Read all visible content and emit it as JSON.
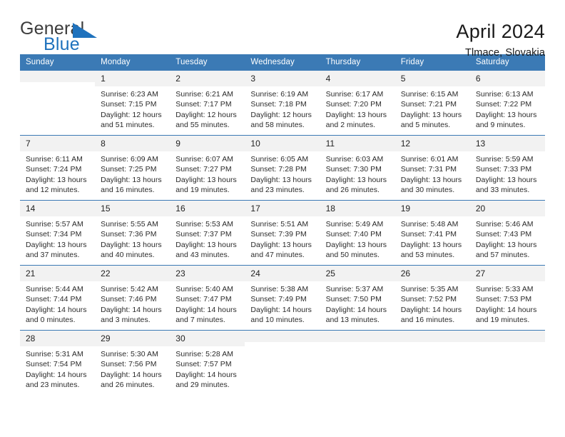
{
  "brand": {
    "word_one": "General",
    "word_two": "Blue",
    "logo_icon": "triangle-icon",
    "accent_color": "#1f72bd"
  },
  "header": {
    "month_title": "April 2024",
    "location": "Tlmace, Slovakia"
  },
  "calendar": {
    "header_color": "#3b7ab5",
    "weekdays": [
      "Sunday",
      "Monday",
      "Tuesday",
      "Wednesday",
      "Thursday",
      "Friday",
      "Saturday"
    ],
    "weeks": [
      [
        {
          "day": ""
        },
        {
          "day": "1",
          "sunrise": "Sunrise: 6:23 AM",
          "sunset": "Sunset: 7:15 PM",
          "daylight_line1": "Daylight: 12 hours",
          "daylight_line2": "and 51 minutes."
        },
        {
          "day": "2",
          "sunrise": "Sunrise: 6:21 AM",
          "sunset": "Sunset: 7:17 PM",
          "daylight_line1": "Daylight: 12 hours",
          "daylight_line2": "and 55 minutes."
        },
        {
          "day": "3",
          "sunrise": "Sunrise: 6:19 AM",
          "sunset": "Sunset: 7:18 PM",
          "daylight_line1": "Daylight: 12 hours",
          "daylight_line2": "and 58 minutes."
        },
        {
          "day": "4",
          "sunrise": "Sunrise: 6:17 AM",
          "sunset": "Sunset: 7:20 PM",
          "daylight_line1": "Daylight: 13 hours",
          "daylight_line2": "and 2 minutes."
        },
        {
          "day": "5",
          "sunrise": "Sunrise: 6:15 AM",
          "sunset": "Sunset: 7:21 PM",
          "daylight_line1": "Daylight: 13 hours",
          "daylight_line2": "and 5 minutes."
        },
        {
          "day": "6",
          "sunrise": "Sunrise: 6:13 AM",
          "sunset": "Sunset: 7:22 PM",
          "daylight_line1": "Daylight: 13 hours",
          "daylight_line2": "and 9 minutes."
        }
      ],
      [
        {
          "day": "7",
          "sunrise": "Sunrise: 6:11 AM",
          "sunset": "Sunset: 7:24 PM",
          "daylight_line1": "Daylight: 13 hours",
          "daylight_line2": "and 12 minutes."
        },
        {
          "day": "8",
          "sunrise": "Sunrise: 6:09 AM",
          "sunset": "Sunset: 7:25 PM",
          "daylight_line1": "Daylight: 13 hours",
          "daylight_line2": "and 16 minutes."
        },
        {
          "day": "9",
          "sunrise": "Sunrise: 6:07 AM",
          "sunset": "Sunset: 7:27 PM",
          "daylight_line1": "Daylight: 13 hours",
          "daylight_line2": "and 19 minutes."
        },
        {
          "day": "10",
          "sunrise": "Sunrise: 6:05 AM",
          "sunset": "Sunset: 7:28 PM",
          "daylight_line1": "Daylight: 13 hours",
          "daylight_line2": "and 23 minutes."
        },
        {
          "day": "11",
          "sunrise": "Sunrise: 6:03 AM",
          "sunset": "Sunset: 7:30 PM",
          "daylight_line1": "Daylight: 13 hours",
          "daylight_line2": "and 26 minutes."
        },
        {
          "day": "12",
          "sunrise": "Sunrise: 6:01 AM",
          "sunset": "Sunset: 7:31 PM",
          "daylight_line1": "Daylight: 13 hours",
          "daylight_line2": "and 30 minutes."
        },
        {
          "day": "13",
          "sunrise": "Sunrise: 5:59 AM",
          "sunset": "Sunset: 7:33 PM",
          "daylight_line1": "Daylight: 13 hours",
          "daylight_line2": "and 33 minutes."
        }
      ],
      [
        {
          "day": "14",
          "sunrise": "Sunrise: 5:57 AM",
          "sunset": "Sunset: 7:34 PM",
          "daylight_line1": "Daylight: 13 hours",
          "daylight_line2": "and 37 minutes."
        },
        {
          "day": "15",
          "sunrise": "Sunrise: 5:55 AM",
          "sunset": "Sunset: 7:36 PM",
          "daylight_line1": "Daylight: 13 hours",
          "daylight_line2": "and 40 minutes."
        },
        {
          "day": "16",
          "sunrise": "Sunrise: 5:53 AM",
          "sunset": "Sunset: 7:37 PM",
          "daylight_line1": "Daylight: 13 hours",
          "daylight_line2": "and 43 minutes."
        },
        {
          "day": "17",
          "sunrise": "Sunrise: 5:51 AM",
          "sunset": "Sunset: 7:39 PM",
          "daylight_line1": "Daylight: 13 hours",
          "daylight_line2": "and 47 minutes."
        },
        {
          "day": "18",
          "sunrise": "Sunrise: 5:49 AM",
          "sunset": "Sunset: 7:40 PM",
          "daylight_line1": "Daylight: 13 hours",
          "daylight_line2": "and 50 minutes."
        },
        {
          "day": "19",
          "sunrise": "Sunrise: 5:48 AM",
          "sunset": "Sunset: 7:41 PM",
          "daylight_line1": "Daylight: 13 hours",
          "daylight_line2": "and 53 minutes."
        },
        {
          "day": "20",
          "sunrise": "Sunrise: 5:46 AM",
          "sunset": "Sunset: 7:43 PM",
          "daylight_line1": "Daylight: 13 hours",
          "daylight_line2": "and 57 minutes."
        }
      ],
      [
        {
          "day": "21",
          "sunrise": "Sunrise: 5:44 AM",
          "sunset": "Sunset: 7:44 PM",
          "daylight_line1": "Daylight: 14 hours",
          "daylight_line2": "and 0 minutes."
        },
        {
          "day": "22",
          "sunrise": "Sunrise: 5:42 AM",
          "sunset": "Sunset: 7:46 PM",
          "daylight_line1": "Daylight: 14 hours",
          "daylight_line2": "and 3 minutes."
        },
        {
          "day": "23",
          "sunrise": "Sunrise: 5:40 AM",
          "sunset": "Sunset: 7:47 PM",
          "daylight_line1": "Daylight: 14 hours",
          "daylight_line2": "and 7 minutes."
        },
        {
          "day": "24",
          "sunrise": "Sunrise: 5:38 AM",
          "sunset": "Sunset: 7:49 PM",
          "daylight_line1": "Daylight: 14 hours",
          "daylight_line2": "and 10 minutes."
        },
        {
          "day": "25",
          "sunrise": "Sunrise: 5:37 AM",
          "sunset": "Sunset: 7:50 PM",
          "daylight_line1": "Daylight: 14 hours",
          "daylight_line2": "and 13 minutes."
        },
        {
          "day": "26",
          "sunrise": "Sunrise: 5:35 AM",
          "sunset": "Sunset: 7:52 PM",
          "daylight_line1": "Daylight: 14 hours",
          "daylight_line2": "and 16 minutes."
        },
        {
          "day": "27",
          "sunrise": "Sunrise: 5:33 AM",
          "sunset": "Sunset: 7:53 PM",
          "daylight_line1": "Daylight: 14 hours",
          "daylight_line2": "and 19 minutes."
        }
      ],
      [
        {
          "day": "28",
          "sunrise": "Sunrise: 5:31 AM",
          "sunset": "Sunset: 7:54 PM",
          "daylight_line1": "Daylight: 14 hours",
          "daylight_line2": "and 23 minutes."
        },
        {
          "day": "29",
          "sunrise": "Sunrise: 5:30 AM",
          "sunset": "Sunset: 7:56 PM",
          "daylight_line1": "Daylight: 14 hours",
          "daylight_line2": "and 26 minutes."
        },
        {
          "day": "30",
          "sunrise": "Sunrise: 5:28 AM",
          "sunset": "Sunset: 7:57 PM",
          "daylight_line1": "Daylight: 14 hours",
          "daylight_line2": "and 29 minutes."
        },
        {
          "day": ""
        },
        {
          "day": ""
        },
        {
          "day": ""
        },
        {
          "day": ""
        }
      ]
    ]
  }
}
